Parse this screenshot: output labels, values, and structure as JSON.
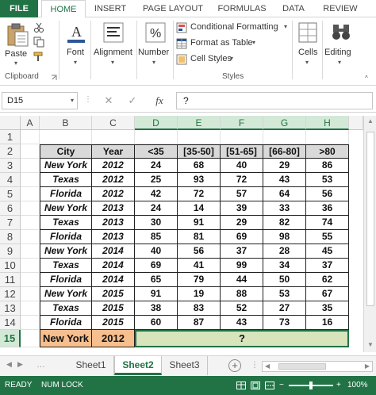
{
  "ribbon_tabs": [
    "FILE",
    "HOME",
    "INSERT",
    "PAGE LAYOUT",
    "FORMULAS",
    "DATA",
    "REVIEW"
  ],
  "ribbon": {
    "paste": "Paste",
    "clipboard": "Clipboard",
    "font": "Font",
    "alignment": "Alignment",
    "number": "Number",
    "conditional_formatting": "Conditional Formatting",
    "format_as_table": "Format as Table",
    "cell_styles": "Cell Styles",
    "styles": "Styles",
    "cells": "Cells",
    "editing": "Editing"
  },
  "formula_bar": {
    "name_box": "D15",
    "cancel": "✕",
    "enter": "✓",
    "fx": "fx",
    "formula": "?"
  },
  "columns": [
    "A",
    "B",
    "C",
    "D",
    "E",
    "F",
    "G",
    "H"
  ],
  "selected_columns": [
    "D",
    "E",
    "F",
    "G",
    "H"
  ],
  "rows": [
    "1",
    "2",
    "3",
    "4",
    "5",
    "6",
    "7",
    "8",
    "9",
    "10",
    "11",
    "12",
    "13",
    "14",
    "15"
  ],
  "selected_row": "15",
  "table": {
    "headers": [
      "City",
      "Year",
      "<35",
      "[35-50]",
      "[51-65]",
      "[66-80]",
      ">80"
    ],
    "rows": [
      [
        "New York",
        "2012",
        "24",
        "68",
        "40",
        "29",
        "86"
      ],
      [
        "Texas",
        "2012",
        "25",
        "93",
        "72",
        "43",
        "53"
      ],
      [
        "Florida",
        "2012",
        "42",
        "72",
        "57",
        "64",
        "56"
      ],
      [
        "New York",
        "2013",
        "24",
        "14",
        "39",
        "33",
        "36"
      ],
      [
        "Texas",
        "2013",
        "30",
        "91",
        "29",
        "82",
        "74"
      ],
      [
        "Florida",
        "2013",
        "85",
        "81",
        "69",
        "98",
        "55"
      ],
      [
        "New York",
        "2014",
        "40",
        "56",
        "37",
        "28",
        "45"
      ],
      [
        "Texas",
        "2014",
        "69",
        "41",
        "99",
        "34",
        "37"
      ],
      [
        "Florida",
        "2014",
        "65",
        "79",
        "44",
        "50",
        "62"
      ],
      [
        "New York",
        "2015",
        "91",
        "19",
        "88",
        "53",
        "67"
      ],
      [
        "Texas",
        "2015",
        "38",
        "83",
        "52",
        "27",
        "35"
      ],
      [
        "Florida",
        "2015",
        "60",
        "87",
        "43",
        "73",
        "16"
      ]
    ],
    "lookup_city": "New York",
    "lookup_year": "2012",
    "result": "?"
  },
  "sheets": [
    "Sheet1",
    "Sheet2",
    "Sheet3"
  ],
  "active_sheet": "Sheet2",
  "status": {
    "ready": "READY",
    "num_lock": "NUM LOCK",
    "zoom": "100%"
  },
  "colors": {
    "accent": "#217346",
    "header_fill": "#d9d9d9",
    "lookup_fill": "#f7be8e",
    "result_fill": "#d8e4bc"
  }
}
